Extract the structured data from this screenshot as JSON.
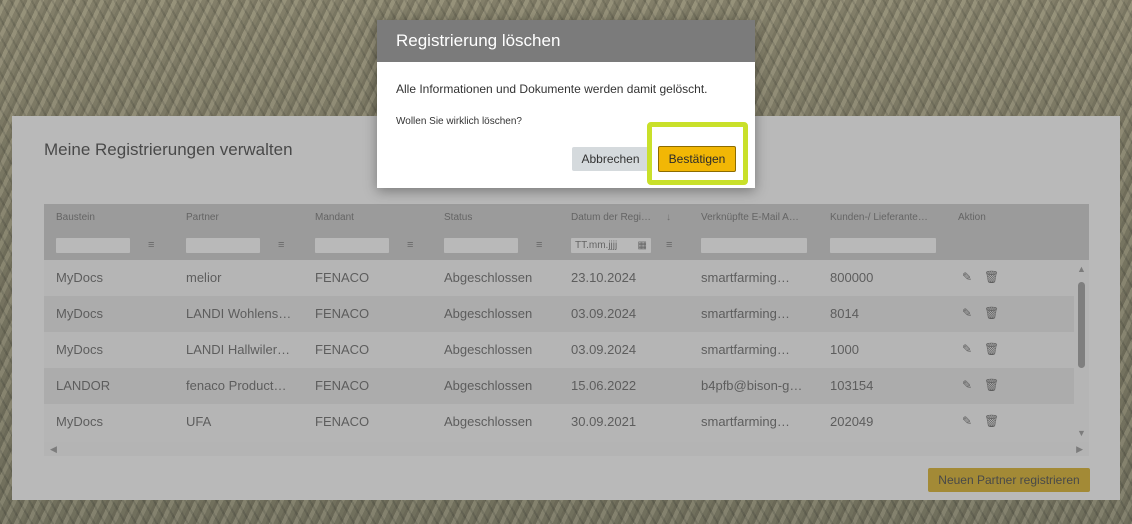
{
  "colors": {
    "accent": "#f2b705",
    "accent_dimmed": "#b5900f",
    "highlight": "#c9e02a",
    "dialog_header": "#7b7b7b"
  },
  "page": {
    "title": "Meine Registrierungen verwalten",
    "new_button": "Neuen Partner registrieren"
  },
  "grid": {
    "columns": [
      {
        "label": "Baustein",
        "filter": "text"
      },
      {
        "label": "Partner",
        "filter": "text"
      },
      {
        "label": "Mandant",
        "filter": "text"
      },
      {
        "label": "Status",
        "filter": "text"
      },
      {
        "label": "Datum der Regi…",
        "sort_icon": "arrow-down-icon",
        "filter": "date",
        "placeholder": "TT.mm.jjjj"
      },
      {
        "label": "Verknüpfte E-Mail A…",
        "filter": "text"
      },
      {
        "label": "Kunden-/ Lieferante…",
        "filter": "text"
      },
      {
        "label": "Aktion"
      }
    ],
    "sort_arrow": "↓",
    "rows": [
      [
        "MyDocs",
        "melior",
        "FENACO",
        "Abgeschlossen",
        "23.10.2024",
        "smartfarming…",
        "800000"
      ],
      [
        "MyDocs",
        "LANDI Wohlens…",
        "FENACO",
        "Abgeschlossen",
        "03.09.2024",
        "smartfarming…",
        "8014"
      ],
      [
        "MyDocs",
        "LANDI Hallwiler…",
        "FENACO",
        "Abgeschlossen",
        "03.09.2024",
        "smartfarming…",
        "1000"
      ],
      [
        "LANDOR",
        "fenaco Product…",
        "FENACO",
        "Abgeschlossen",
        "15.06.2022",
        "b4pfb@bison-g…",
        "103154"
      ],
      [
        "MyDocs",
        "UFA",
        "FENACO",
        "Abgeschlossen",
        "30.09.2021",
        "smartfarming…",
        "202049"
      ]
    ],
    "actions": [
      "edit-icon",
      "delete-icon"
    ]
  },
  "dialog": {
    "title": "Registrierung löschen",
    "message": "Alle Informationen und Dokumente werden damit gelöscht.",
    "question": "Wollen Sie wirklich löschen?",
    "cancel": "Abbrechen",
    "confirm": "Bestätigen"
  }
}
